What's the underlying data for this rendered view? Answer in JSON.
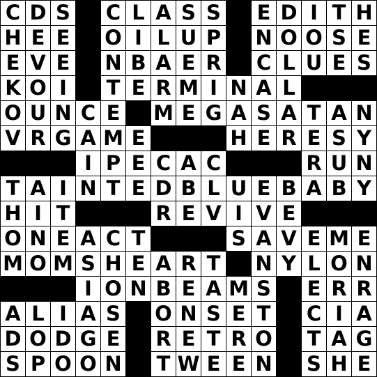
{
  "puzzle": {
    "colors": {
      "block": "#000000",
      "cell": "#ffffff",
      "letter": "#000000"
    },
    "rows": [
      "CDS#CLASS#EDITH",
      "HEE#OILUP#NOOSE",
      "EVE#NBAER#CLUES",
      "KOI#TERMINAL###",
      "OUNCE#MEGASATAN",
      "VRGAME###HERESY",
      "###IPECAC###RUN",
      "TAINTEDBLUEBABY",
      "HIT###REVIVE###",
      "ONEACT###SAVEME",
      "MOMSHEART#NYLON",
      "###IONBEAMS#ERR",
      "ALIAS#ONSET#CIA",
      "DODGE#RETRO#TAG",
      "SPOON#TWEEN#SHE"
    ]
  }
}
